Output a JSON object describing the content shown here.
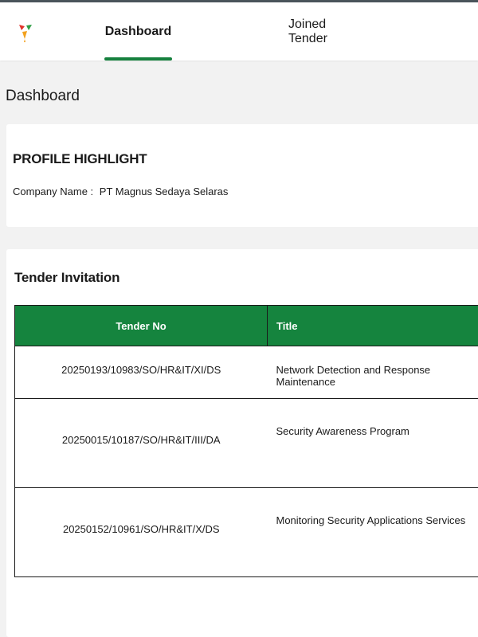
{
  "header": {
    "logo_icon": "colorful-logo-icon",
    "tabs": [
      {
        "label": "Dashboard",
        "active": true
      },
      {
        "label": "Joined Tender",
        "active": false
      }
    ],
    "accent_color": "#15803d"
  },
  "page": {
    "title": "Dashboard"
  },
  "profile": {
    "heading": "PROFILE HIGHLIGHT",
    "company_label": "Company Name :",
    "company_value": "PT Magnus Sedaya Selaras"
  },
  "tender": {
    "heading": "Tender Invitation",
    "columns": [
      "Tender No",
      "Title"
    ],
    "rows": [
      {
        "no": "20250193/10983/SO/HR&IT/XI/DS",
        "title": "Network Detection and Response Maintenance"
      },
      {
        "no": "20250015/10187/SO/HR&IT/III/DA",
        "title": "Security Awareness Program"
      },
      {
        "no": "20250152/10961/SO/HR&IT/X/DS",
        "title": "Monitoring Security Applications Services"
      }
    ],
    "header_color": "#15843e"
  }
}
